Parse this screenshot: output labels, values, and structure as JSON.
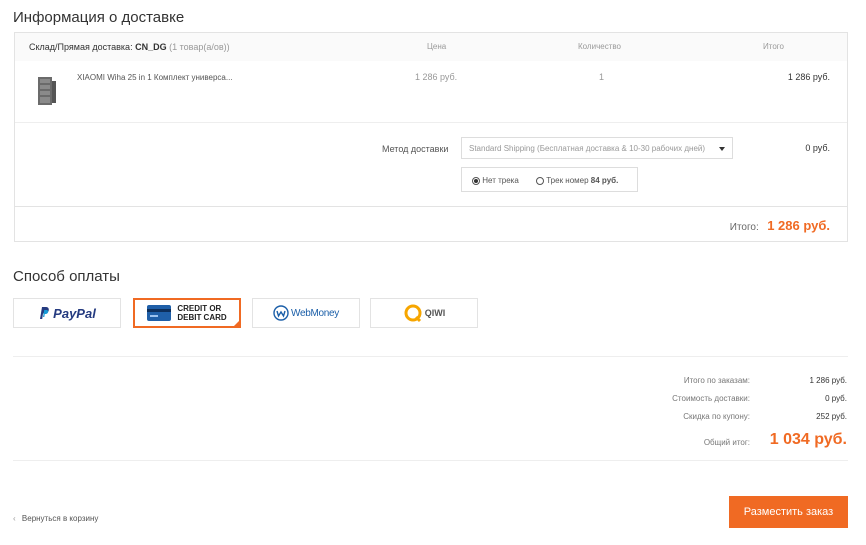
{
  "delivery": {
    "title": "Информация о доставке",
    "warehouse_label": "Склад/Прямая доставка:",
    "warehouse_code": "CN_DG",
    "warehouse_count": "(1 товар(а/ов))",
    "col_price": "Цена",
    "col_qty": "Количество",
    "col_total": "Итого",
    "item": {
      "name": "XIAOMI Wiha 25 in 1 Комплект универса...",
      "price": "1 286 руб.",
      "qty": "1",
      "total": "1 286 руб."
    },
    "shipping_method_label": "Метод доставки",
    "shipping_method_value": "Standard Shipping (Бесплатная доставка & 10-30 рабочих дней)",
    "shipping_cost": "0 руб.",
    "track_options": [
      {
        "label": "Нет трека",
        "selected": true
      },
      {
        "label": "Трек номер",
        "extra": "84 руб.",
        "selected": false
      }
    ],
    "subtotal_label": "Итого:",
    "subtotal_value": "1 286 руб."
  },
  "payment": {
    "title": "Способ оплаты",
    "methods": [
      {
        "label": "PayPal",
        "selected": false
      },
      {
        "label_line1": "CREDIT OR",
        "label_line2": "DEBIT CARD",
        "selected": true
      },
      {
        "label": "WebMoney",
        "selected": false
      },
      {
        "label": "QIWI",
        "selected": false
      }
    ]
  },
  "summary": {
    "orders_total_label": "Итого по заказам:",
    "orders_total_value": "1 286 руб.",
    "shipping_label": "Стоимость доставки:",
    "shipping_value": "0 руб.",
    "coupon_label": "Скидка по купону:",
    "coupon_value": "252 руб.",
    "grand_total_label": "Общий итог:",
    "grand_total_value": "1 034 руб."
  },
  "footer": {
    "back_link": "Вернуться в корзину",
    "place_order": "Разместить заказ"
  },
  "colors": {
    "accent": "#f06a23",
    "paypal_dark": "#253b80",
    "paypal_light": "#179bd7"
  }
}
